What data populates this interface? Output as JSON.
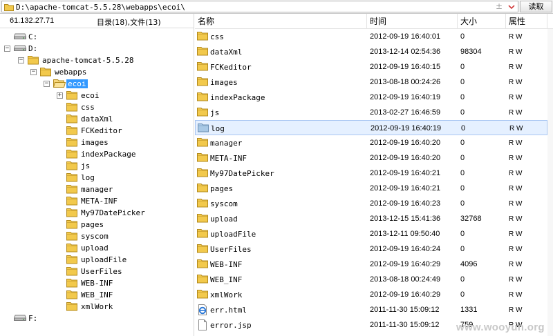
{
  "address": {
    "path": "D:\\apache-tomcat-5.5.28\\webapps\\ecoi\\",
    "plus": "±",
    "go_label": "读取"
  },
  "left": {
    "host": "61.132.27.71",
    "summary": "目录(18),文件(13)"
  },
  "tree": {
    "nodes": [
      {
        "label": "C:",
        "type": "drive",
        "expander": ""
      },
      {
        "label": "D:",
        "type": "drive",
        "expander": "−"
      },
      {
        "label": "apache-tomcat-5.5.28",
        "type": "folder",
        "expander": "−"
      },
      {
        "label": "webapps",
        "type": "folder",
        "expander": "−"
      },
      {
        "label": "ecoi",
        "type": "folder-open",
        "expander": "−"
      },
      {
        "label": "ecoi",
        "type": "folder",
        "expander": "+"
      },
      {
        "label": "css",
        "type": "folder",
        "expander": ""
      },
      {
        "label": "dataXml",
        "type": "folder",
        "expander": ""
      },
      {
        "label": "FCKeditor",
        "type": "folder",
        "expander": ""
      },
      {
        "label": "images",
        "type": "folder",
        "expander": ""
      },
      {
        "label": "indexPackage",
        "type": "folder",
        "expander": ""
      },
      {
        "label": "js",
        "type": "folder",
        "expander": ""
      },
      {
        "label": "log",
        "type": "folder",
        "expander": ""
      },
      {
        "label": "manager",
        "type": "folder",
        "expander": ""
      },
      {
        "label": "META-INF",
        "type": "folder",
        "expander": ""
      },
      {
        "label": "My97DatePicker",
        "type": "folder",
        "expander": ""
      },
      {
        "label": "pages",
        "type": "folder",
        "expander": ""
      },
      {
        "label": "syscom",
        "type": "folder",
        "expander": ""
      },
      {
        "label": "upload",
        "type": "folder",
        "expander": ""
      },
      {
        "label": "uploadFile",
        "type": "folder",
        "expander": ""
      },
      {
        "label": "UserFiles",
        "type": "folder",
        "expander": ""
      },
      {
        "label": "WEB-INF",
        "type": "folder",
        "expander": ""
      },
      {
        "label": "WEB_INF",
        "type": "folder",
        "expander": ""
      },
      {
        "label": "xmlWork",
        "type": "folder",
        "expander": ""
      },
      {
        "label": "F:",
        "type": "drive",
        "expander": ""
      }
    ]
  },
  "columns": {
    "name": "名称",
    "time": "时间",
    "size": "大小",
    "attr": "属性"
  },
  "files": [
    {
      "name": "css",
      "time": "2012-09-19 16:40:01",
      "size": "0",
      "attr": "R W",
      "icon": "folder"
    },
    {
      "name": "dataXml",
      "time": "2013-12-14 02:54:36",
      "size": "98304",
      "attr": "R W",
      "icon": "folder"
    },
    {
      "name": "FCKeditor",
      "time": "2012-09-19 16:40:15",
      "size": "0",
      "attr": "R W",
      "icon": "folder"
    },
    {
      "name": "images",
      "time": "2013-08-18 00:24:26",
      "size": "0",
      "attr": "R W",
      "icon": "folder"
    },
    {
      "name": "indexPackage",
      "time": "2012-09-19 16:40:19",
      "size": "0",
      "attr": "R W",
      "icon": "folder"
    },
    {
      "name": "js",
      "time": "2013-02-27 16:46:59",
      "size": "0",
      "attr": "R W",
      "icon": "folder"
    },
    {
      "name": "log",
      "time": "2012-09-19 16:40:19",
      "size": "0",
      "attr": "R W",
      "icon": "folder-blue",
      "highlight": true
    },
    {
      "name": "manager",
      "time": "2012-09-19 16:40:20",
      "size": "0",
      "attr": "R W",
      "icon": "folder"
    },
    {
      "name": "META-INF",
      "time": "2012-09-19 16:40:20",
      "size": "0",
      "attr": "R W",
      "icon": "folder"
    },
    {
      "name": "My97DatePicker",
      "time": "2012-09-19 16:40:21",
      "size": "0",
      "attr": "R W",
      "icon": "folder"
    },
    {
      "name": "pages",
      "time": "2012-09-19 16:40:21",
      "size": "0",
      "attr": "R W",
      "icon": "folder"
    },
    {
      "name": "syscom",
      "time": "2012-09-19 16:40:23",
      "size": "0",
      "attr": "R W",
      "icon": "folder"
    },
    {
      "name": "upload",
      "time": "2013-12-15 15:41:36",
      "size": "32768",
      "attr": "R W",
      "icon": "folder"
    },
    {
      "name": "uploadFile",
      "time": "2013-12-11 09:50:40",
      "size": "0",
      "attr": "R W",
      "icon": "folder"
    },
    {
      "name": "UserFiles",
      "time": "2012-09-19 16:40:24",
      "size": "0",
      "attr": "R W",
      "icon": "folder"
    },
    {
      "name": "WEB-INF",
      "time": "2012-09-19 16:40:29",
      "size": "4096",
      "attr": "R W",
      "icon": "folder"
    },
    {
      "name": "WEB_INF",
      "time": "2013-08-18 00:24:49",
      "size": "0",
      "attr": "R W",
      "icon": "folder"
    },
    {
      "name": "xmlWork",
      "time": "2012-09-19 16:40:29",
      "size": "0",
      "attr": "R W",
      "icon": "folder"
    },
    {
      "name": "err.html",
      "time": "2011-11-30 15:09:12",
      "size": "1331",
      "attr": "R W",
      "icon": "ie-file"
    },
    {
      "name": "error.jsp",
      "time": "2011-11-30 15:09:12",
      "size": "759",
      "attr": "R W",
      "icon": "file"
    }
  ],
  "watermark": "www.wooyun.org",
  "colors": {
    "folder": "#f2c94c",
    "selection": "#3399ff",
    "row_highlight": "#e5f0ff"
  }
}
